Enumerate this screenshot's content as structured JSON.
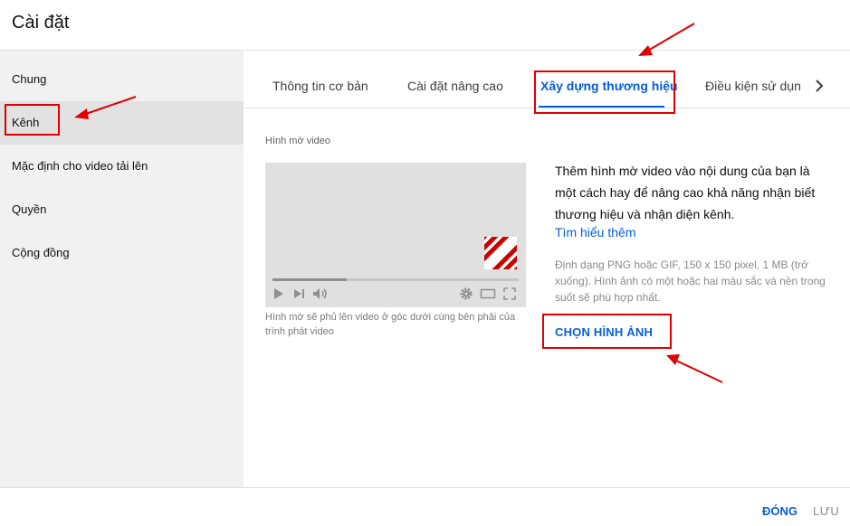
{
  "header": {
    "title": "Cài đặt"
  },
  "sidebar": {
    "items": [
      {
        "label": "Chung"
      },
      {
        "label": "Kênh"
      },
      {
        "label": "Mặc định cho video tải lên"
      },
      {
        "label": "Quyền"
      },
      {
        "label": "Cộng đồng"
      }
    ],
    "active_index": 1
  },
  "tabs": {
    "items": [
      {
        "label": "Thông tin cơ bản"
      },
      {
        "label": "Cài đặt nâng cao"
      },
      {
        "label": "Xây dựng thương hiệu"
      },
      {
        "label": "Điều kiện sử dụn"
      }
    ],
    "active_index": 2,
    "next_icon": "chevron-right-icon"
  },
  "watermark": {
    "section_label": "Hình mờ video",
    "preview_caption": "Hình mờ sẽ phủ lên video ở góc dưới cùng bên phải của trình phát video",
    "progress_fraction": 0.3,
    "controls": [
      "play-icon",
      "skip-next-icon",
      "volume-icon",
      "settings-icon",
      "theater-mode-icon",
      "fullscreen-icon"
    ],
    "description": "Thêm hình mờ video vào nội dung của bạn là một cách hay để nâng cao khả năng nhận biết thương hiệu và nhận diện kênh.",
    "learn_more": "Tìm hiểu thêm",
    "format_note": "Định dạng PNG hoặc GIF, 150 x 150 pixel, 1 MB (trở xuống). Hình ảnh có một hoặc hai màu sắc và nền trong suốt sẽ phù hợp nhất.",
    "choose_button": "CHỌN HÌNH ẢNH"
  },
  "footer": {
    "close_label": "ĐÓNG",
    "save_label": "LƯU"
  },
  "colors": {
    "accent": "#065fd4",
    "annotation": "#e00000",
    "watermark_stripe": "#cc0000"
  }
}
